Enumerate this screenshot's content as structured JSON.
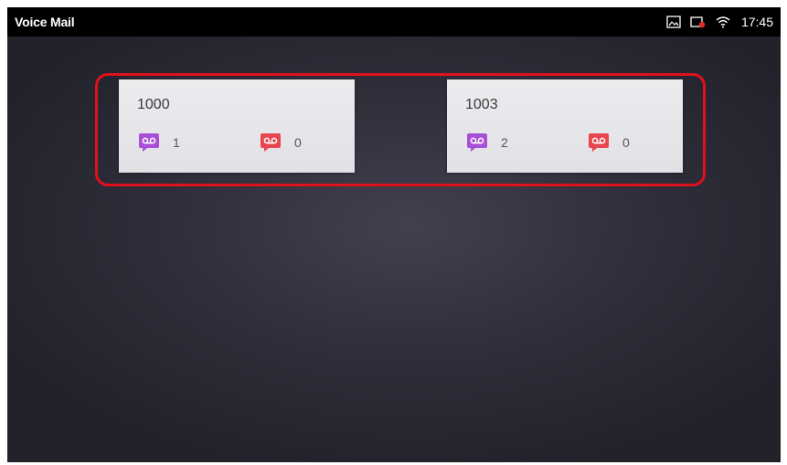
{
  "statusbar": {
    "title": "Voice Mail",
    "time": "17:45",
    "icons": [
      "gallery-icon",
      "sim-card-icon",
      "wifi-icon"
    ]
  },
  "accounts": [
    {
      "number": "1000",
      "new_count": "1",
      "urgent_count": "0"
    },
    {
      "number": "1003",
      "new_count": "2",
      "urgent_count": "0"
    }
  ],
  "colors": {
    "status_bar": "#000000",
    "new_voicemail_icon": "#a84fd8",
    "urgent_voicemail_icon": "#e8464e",
    "highlight_border": "#e0101c"
  }
}
